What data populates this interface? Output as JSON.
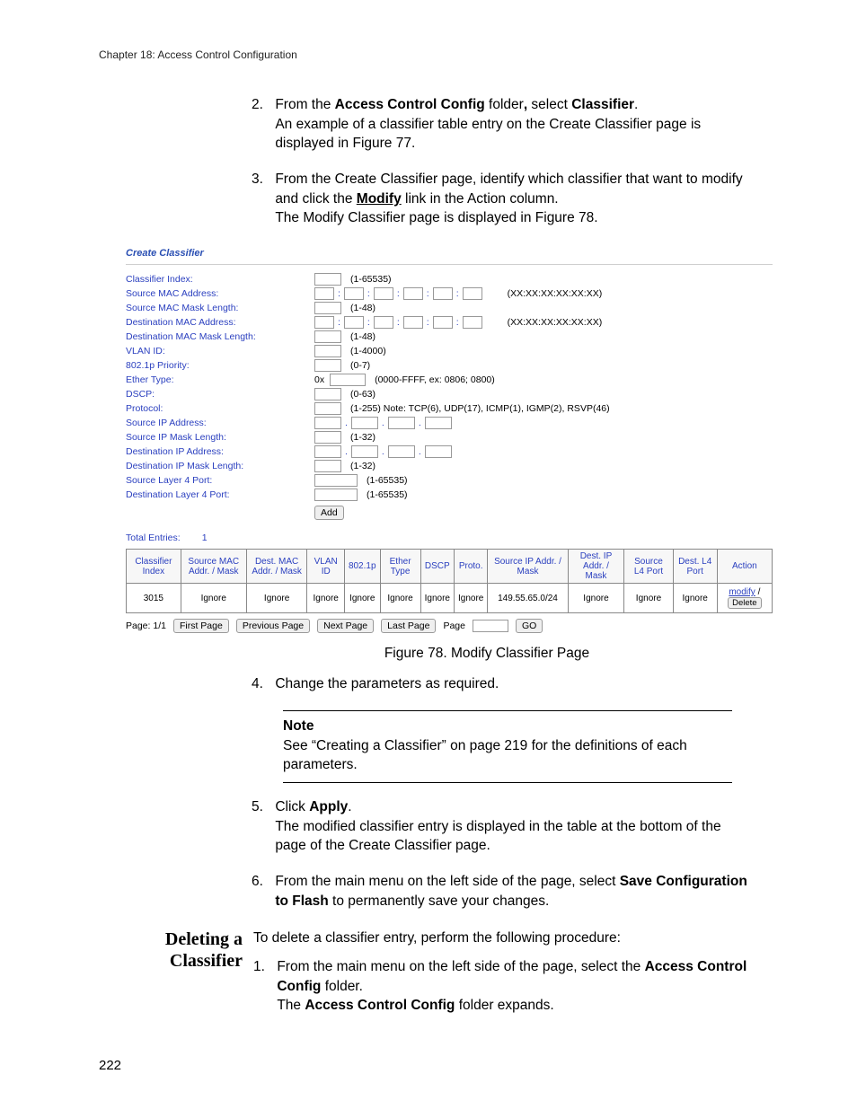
{
  "chapter_header": "Chapter 18: Access Control Configuration",
  "steps": {
    "s2": {
      "num": "2.",
      "text_before": "From the ",
      "bold1": "Access Control Config",
      "text_mid1": " folder",
      "punc": ",",
      "text_mid2": " select ",
      "bold2": "Classifier",
      "text_after": ".",
      "line2": "An example of a classifier table entry on the Create Classifier page is displayed in Figure 77."
    },
    "s3": {
      "num": "3.",
      "line1_a": "From the Create Classifier page, identify which classifier that want to modify and click the ",
      "bold1": "Modify",
      "line1_b": " link in the Action column.",
      "line2": "The Modify Classifier page is displayed in Figure 78."
    },
    "s4": {
      "num": "4.",
      "text": "Change the parameters as required."
    },
    "s5": {
      "num": "5.",
      "text_a": "Click ",
      "bold": "Apply",
      "text_b": ".",
      "line2": "The modified classifier entry is displayed in the table at the bottom of the page of the Create Classifier page."
    },
    "s6": {
      "num": "6.",
      "text_a": "From the main menu on the left side of the page, select ",
      "bold": "Save Configuration to Flash",
      "text_b": " to permanently save your changes."
    }
  },
  "panel": {
    "title": "Create Classifier",
    "fields": {
      "classifier_index": {
        "label": "Classifier Index:",
        "helper": "(1-65535)"
      },
      "src_mac": {
        "label": "Source MAC Address:",
        "helper": "(XX:XX:XX:XX:XX:XX)"
      },
      "src_mac_mask": {
        "label": "Source MAC Mask Length:",
        "helper": "(1-48)"
      },
      "dst_mac": {
        "label": "Destination MAC Address:",
        "helper": "(XX:XX:XX:XX:XX:XX)"
      },
      "dst_mac_mask": {
        "label": "Destination MAC Mask Length:",
        "helper": "(1-48)"
      },
      "vlan_id": {
        "label": "VLAN ID:",
        "helper": "(1-4000)"
      },
      "priority": {
        "label": "802.1p Priority:",
        "helper": "(0-7)"
      },
      "ether_type": {
        "label": "Ether Type:",
        "prefix": "0x",
        "helper": "(0000-FFFF, ex: 0806; 0800)"
      },
      "dscp": {
        "label": "DSCP:",
        "helper": "(0-63)"
      },
      "protocol": {
        "label": "Protocol:",
        "helper": "(1-255) Note: TCP(6), UDP(17), ICMP(1), IGMP(2), RSVP(46)"
      },
      "src_ip": {
        "label": "Source IP Address:"
      },
      "src_ip_mask": {
        "label": "Source IP Mask Length:",
        "helper": "(1-32)"
      },
      "dst_ip": {
        "label": "Destination IP Address:"
      },
      "dst_ip_mask": {
        "label": "Destination IP Mask Length:",
        "helper": "(1-32)"
      },
      "src_l4": {
        "label": "Source Layer 4 Port:",
        "helper": "(1-65535)"
      },
      "dst_l4": {
        "label": "Destination Layer 4 Port:",
        "helper": "(1-65535)"
      }
    },
    "add_button": "Add",
    "total_entries_label": "Total Entries:",
    "total_entries_value": "1",
    "table_headers": [
      "Classifier Index",
      "Source MAC Addr. / Mask",
      "Dest. MAC Addr. / Mask",
      "VLAN ID",
      "802.1p",
      "Ether Type",
      "DSCP",
      "Proto.",
      "Source IP Addr. / Mask",
      "Dest. IP Addr. / Mask",
      "Source L4 Port",
      "Dest. L4 Port",
      "Action"
    ],
    "table_row": {
      "index": "3015",
      "src_mac": "Ignore",
      "dst_mac": "Ignore",
      "vlan": "Ignore",
      "p8021": "Ignore",
      "ether": "Ignore",
      "dscp": "Ignore",
      "proto": "Ignore",
      "src_ip": "149.55.65.0/24",
      "dst_ip": "Ignore",
      "src_l4": "Ignore",
      "dst_l4": "Ignore",
      "action_modify": "modify",
      "action_delete": "Delete"
    },
    "pager": {
      "page_label": "Page: 1/1",
      "first": "First Page",
      "prev": "Previous Page",
      "next": "Next Page",
      "last": "Last Page",
      "input_label": "Page",
      "go": "GO"
    }
  },
  "figure_caption": "Figure 78. Modify Classifier Page",
  "note": {
    "title": "Note",
    "body": "See “Creating a Classifier” on page 219 for the definitions of each parameters."
  },
  "deleting": {
    "heading": "Deleting a Classifier",
    "intro": "To delete a classifier entry, perform the following procedure:",
    "step1": {
      "num": "1.",
      "text_a": "From the main menu on the left side of the page, select the ",
      "bold1": "Access Control Config",
      "text_b": " folder.",
      "line2_a": "The ",
      "bold2": "Access Control Config",
      "line2_b": " folder expands."
    }
  },
  "page_number": "222"
}
